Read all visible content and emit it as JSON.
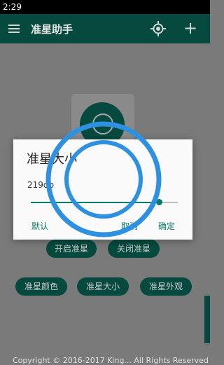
{
  "status": {
    "time": "2:29"
  },
  "appbar": {
    "title": "准星助手",
    "menu_icon": "menu-icon",
    "target_icon": "target-icon",
    "add_icon": "plus-icon"
  },
  "buttons": {
    "open": "开启准星",
    "close": "关闭准星",
    "color": "准星颜色",
    "size": "准星大小",
    "look": "准星外观"
  },
  "footer": {
    "copyright": "Copyright © 2016-2017 King... All Rights Reserved"
  },
  "dialog": {
    "title": "准星大小",
    "value": "219dp",
    "slider_fraction": 0.87,
    "default_label": "默认",
    "cancel_label": "取消",
    "ok_label": "确定"
  },
  "colors": {
    "primary": "#064a3f",
    "accent": "#0a7a67",
    "crosshair": "#2e90e0"
  }
}
